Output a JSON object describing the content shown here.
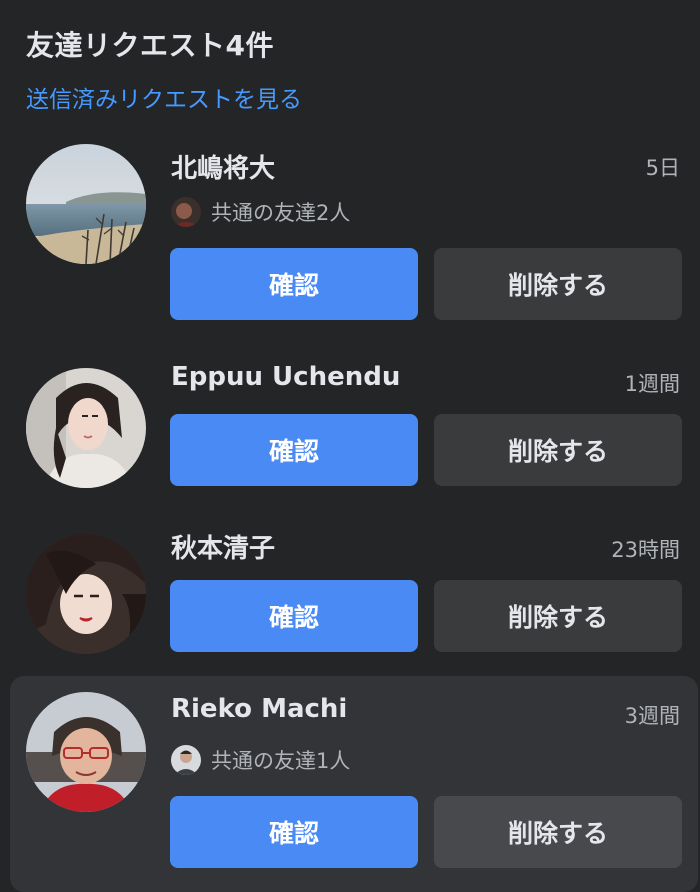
{
  "header": {
    "title": "友達リクエスト4件",
    "sent_requests_link": "送信済みリクエストを見る"
  },
  "colors": {
    "background": "#242527",
    "highlight_row": "#333437",
    "confirm_button": "#4a8af4",
    "delete_button": "#3a3b3d",
    "link": "#4599ff"
  },
  "requests": [
    {
      "name": "北嶋将大",
      "time": "5日",
      "mutual": "共通の友達2人",
      "confirm_label": "確認",
      "delete_label": "削除する"
    },
    {
      "name": "Eppuu Uchendu",
      "time": "1週間",
      "confirm_label": "確認",
      "delete_label": "削除する"
    },
    {
      "name": "秋本清子",
      "time": "23時間",
      "confirm_label": "確認",
      "delete_label": "削除する"
    },
    {
      "name": "Rieko Machi",
      "time": "3週間",
      "mutual": "共通の友達1人",
      "confirm_label": "確認",
      "delete_label": "削除する"
    }
  ]
}
